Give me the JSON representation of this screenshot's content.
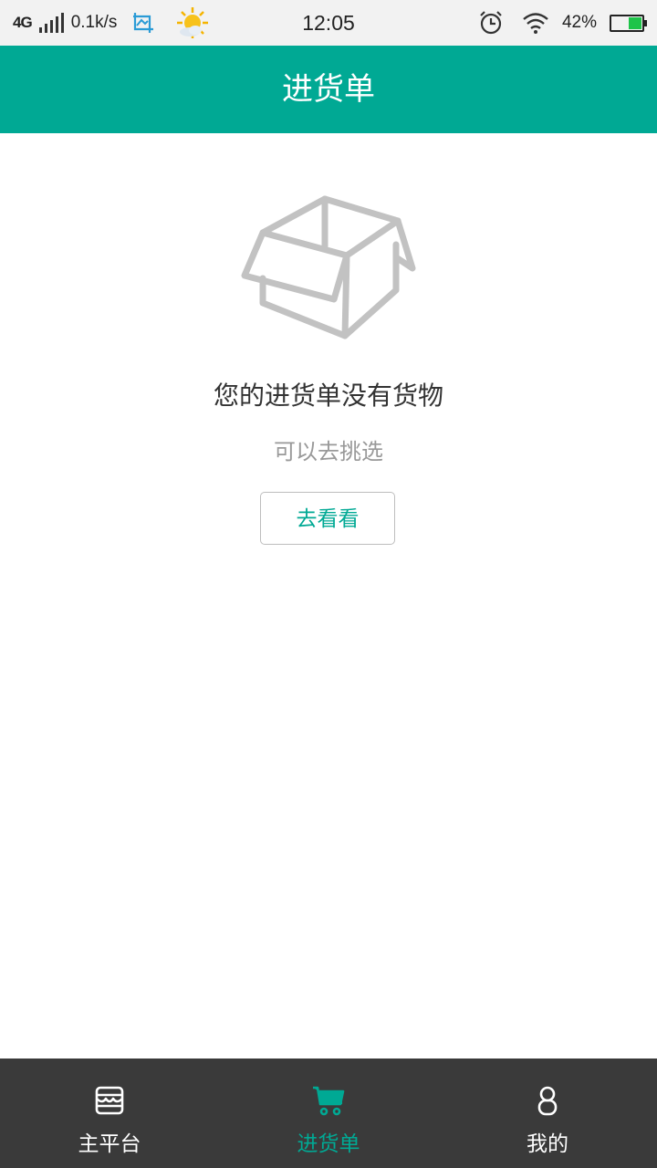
{
  "status_bar": {
    "network": "4G",
    "speed": "0.1k/s",
    "time": "12:05",
    "battery_percent": "42%",
    "battery_level": 0.42,
    "icons": [
      "signal-icon",
      "screenshot-icon",
      "weather-sunny-icon",
      "alarm-icon",
      "wifi-icon",
      "battery-icon"
    ]
  },
  "header": {
    "title": "进货单"
  },
  "empty_state": {
    "icon": "open-box-icon",
    "title": "您的进货单没有货物",
    "subtitle": "可以去挑选",
    "button_label": "去看看"
  },
  "bottom_nav": {
    "items": [
      {
        "label": "主平台",
        "icon": "store-icon",
        "active": false
      },
      {
        "label": "进货单",
        "icon": "cart-icon",
        "active": true
      },
      {
        "label": "我的",
        "icon": "user-icon",
        "active": false
      }
    ]
  },
  "colors": {
    "accent": "#00a994",
    "nav_background": "#3a3a3a",
    "status_background": "#f2f2f2",
    "icon_gray": "#c2c2c2"
  }
}
